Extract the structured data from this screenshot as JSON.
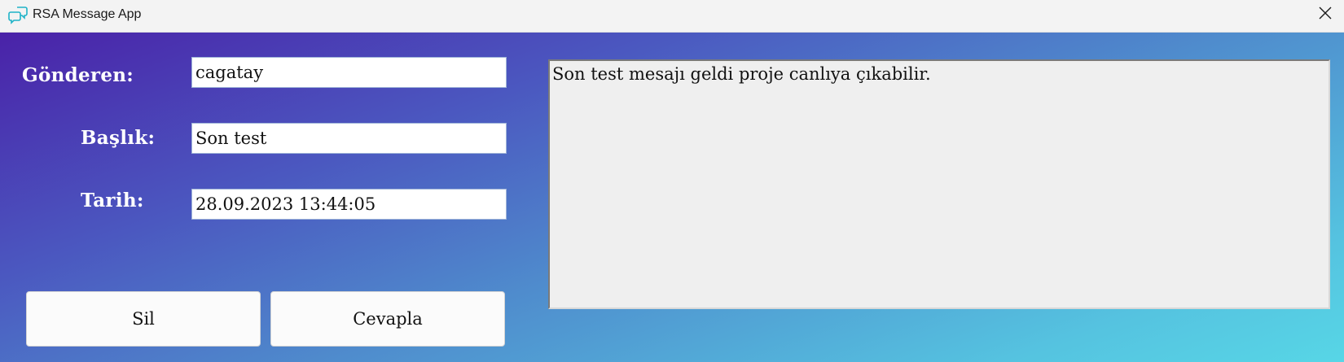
{
  "window": {
    "title": "RSA Message App",
    "icon": "chat-bubbles-icon",
    "close_icon": "close-icon"
  },
  "form": {
    "sender_label": "Gönderen:",
    "sender_value": "cagatay",
    "subject_label": "Başlık:",
    "subject_value": "Son test",
    "date_label": "Tarih:",
    "date_value": "28.09.2023 13:44:05"
  },
  "buttons": {
    "delete_label": "Sil",
    "reply_label": "Cevapla"
  },
  "message": {
    "body": "Son test mesajı geldi proje canlıya çıkabilir."
  },
  "colors": {
    "gradient_start": "#4a22a8",
    "gradient_end": "#57d6e6",
    "titlebar": "#f3f3f3",
    "message_bg": "#efefef",
    "icon_accent": "#1fb3c8"
  }
}
